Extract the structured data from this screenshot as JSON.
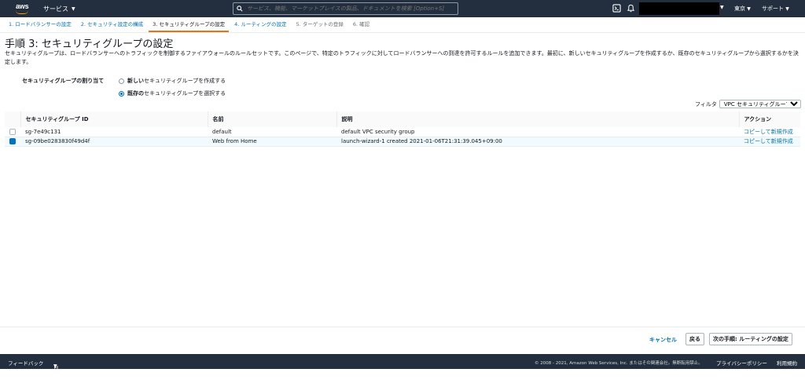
{
  "topnav": {
    "logo": "aws",
    "services_label": "サービス",
    "search_placeholder": "サービス、機能、マーケットプレイスの製品、ドキュメントを検索 [Option+S]",
    "region": "東京",
    "support": "サポート",
    "icons": [
      "search-icon",
      "terminal-icon",
      "bell-icon"
    ]
  },
  "steps": [
    "1. ロードバランサーの設定",
    "2. セキュリティ設定の構成",
    "3. セキュリティグループの設定",
    "4. ルーティングの設定",
    "5. ターゲットの登録",
    "6. 確認"
  ],
  "page": {
    "title": "手順 3: セキュリティグループの設定",
    "description": "セキュリティグループは、ロードバランサーへのトラフィックを制御するファイアウォールのルールセットです。このページで、特定のトラフィックに対してロードバランサーへの到達を許可するルールを追加できます。最初に、新しいセキュリティグループを作成するか、既存のセキュリティグループから選択するかを決定します。"
  },
  "assign": {
    "label": "セキュリティグループの割り当て",
    "option_new_bold": "新しい",
    "option_new_rest": "セキュリティグループを作成する",
    "option_existing_bold": "既存の",
    "option_existing_rest": "セキュリティグループを選択する"
  },
  "filter": {
    "label": "フィルタ",
    "selected": "VPC セキュリティグループ"
  },
  "table": {
    "headers": [
      "セキュリティグループ ID",
      "名前",
      "説明",
      "アクション"
    ],
    "rows": [
      {
        "id": "sg-7e49c131",
        "name": "default",
        "desc": "default VPC security group",
        "action": "コピーして新規作成"
      },
      {
        "id": "sg-09be0283830f49d4f",
        "name": "Web from Home",
        "desc": "launch-wizard-1 created 2021-01-06T21:31:39.045+09:00",
        "action": "コピーして新規作成"
      }
    ]
  },
  "buttons": {
    "cancel": "キャンセル",
    "back": "戻る",
    "next": "次の手順: ルーティングの設定"
  },
  "footer": {
    "feedback": "フィードバック",
    "language": "日本語",
    "copyright": "© 2008 - 2021, Amazon Web Services, Inc. またはその関連会社。無断転用禁止。",
    "privacy": "プライバシーポリシー",
    "terms": "利用規約"
  },
  "colors": {
    "nav_bg": "#232f3e",
    "accent": "#ec7211",
    "link": "#0073bb"
  }
}
